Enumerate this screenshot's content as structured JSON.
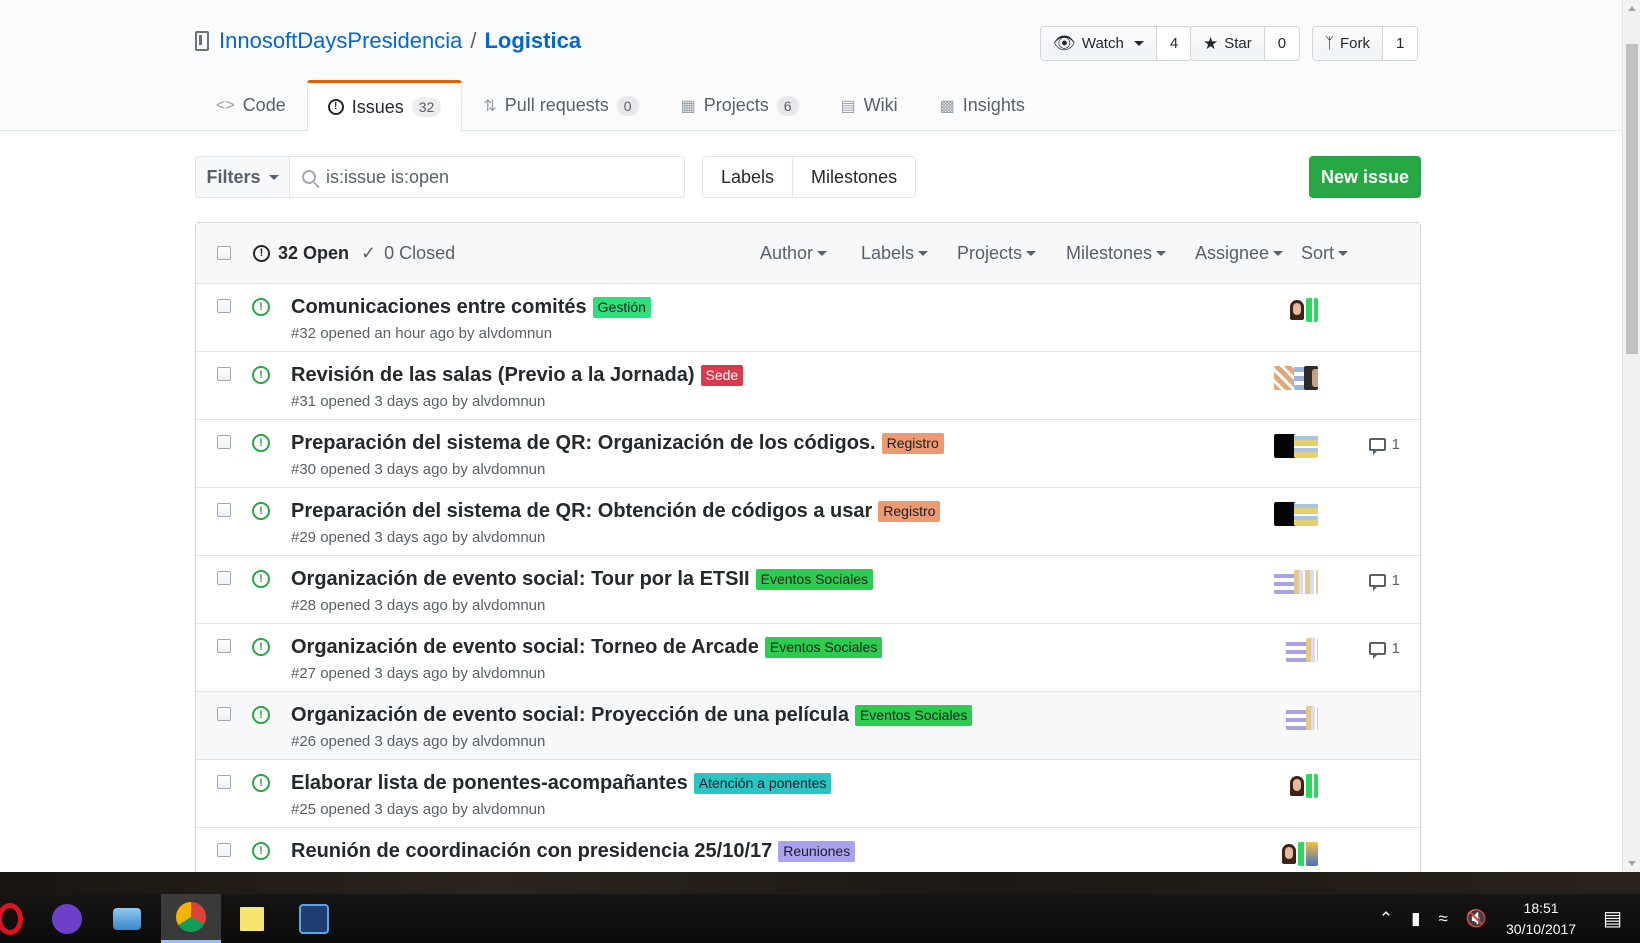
{
  "repo": {
    "owner": "InnosoftDaysPresidencia",
    "separator": "/",
    "name": "Logistica"
  },
  "social": {
    "watch_label": "Watch",
    "watch_count": "4",
    "star_label": "Star",
    "star_count": "0",
    "fork_label": "Fork",
    "fork_count": "1"
  },
  "nav": {
    "code": "Code",
    "issues": "Issues",
    "issues_count": "32",
    "pulls": "Pull requests",
    "pulls_count": "0",
    "projects": "Projects",
    "projects_count": "6",
    "wiki": "Wiki",
    "insights": "Insights"
  },
  "subnav": {
    "filters": "Filters",
    "query": "is:issue is:open",
    "labels": "Labels",
    "milestones": "Milestones",
    "new_issue": "New issue"
  },
  "issues_header": {
    "open": "32 Open",
    "closed": "0 Closed",
    "author": "Author",
    "labels": "Labels",
    "projects": "Projects",
    "milestones": "Milestones",
    "assignee": "Assignee",
    "sort": "Sort"
  },
  "issues": [
    {
      "title": "Comunicaciones entre comités",
      "label": "Gestión",
      "label_bg": "#2ee07a",
      "label_fg": "#1b1f23",
      "meta": "#32 opened an hour ago by alvdomnun",
      "comments": ""
    },
    {
      "title": "Revisión de las salas (Previo a la Jornada)",
      "label": "Sede",
      "label_bg": "#d73a4a",
      "label_fg": "#ffffff",
      "meta": "#31 opened 3 days ago by alvdomnun",
      "comments": ""
    },
    {
      "title": "Preparación del sistema de QR: Organización de los códigos.",
      "label": "Registro",
      "label_bg": "#eb9a71",
      "label_fg": "#1b1f23",
      "meta": "#30 opened 3 days ago by alvdomnun",
      "comments": "1"
    },
    {
      "title": "Preparación del sistema de QR: Obtención de códigos a usar",
      "label": "Registro",
      "label_bg": "#eb9a71",
      "label_fg": "#1b1f23",
      "meta": "#29 opened 3 days ago by alvdomnun",
      "comments": ""
    },
    {
      "title": "Organización de evento social: Tour por la ETSII",
      "label": "Eventos Sociales",
      "label_bg": "#2ccc4f",
      "label_fg": "#1b1f23",
      "meta": "#28 opened 3 days ago by alvdomnun",
      "comments": "1"
    },
    {
      "title": "Organización de evento social: Torneo de Arcade",
      "label": "Eventos Sociales",
      "label_bg": "#2ccc4f",
      "label_fg": "#1b1f23",
      "meta": "#27 opened 3 days ago by alvdomnun",
      "comments": "1"
    },
    {
      "title": "Organización de evento social: Proyección de una película",
      "label": "Eventos Sociales",
      "label_bg": "#2ccc4f",
      "label_fg": "#1b1f23",
      "meta": "#26 opened 3 days ago by alvdomnun",
      "comments": ""
    },
    {
      "title": "Elaborar lista de ponentes-acompañantes",
      "label": "Atención a ponentes",
      "label_bg": "#2bc4c4",
      "label_fg": "#1b1f23",
      "meta": "#25 opened 3 days ago by alvdomnun",
      "comments": ""
    },
    {
      "title": "Reunión de coordinación con presidencia 25/10/17",
      "label": "Reuniones",
      "label_bg": "#a9a2ee",
      "label_fg": "#1b1f23",
      "meta": "",
      "comments": ""
    }
  ],
  "taskbar": {
    "time": "18:51",
    "date": "30/10/2017"
  }
}
